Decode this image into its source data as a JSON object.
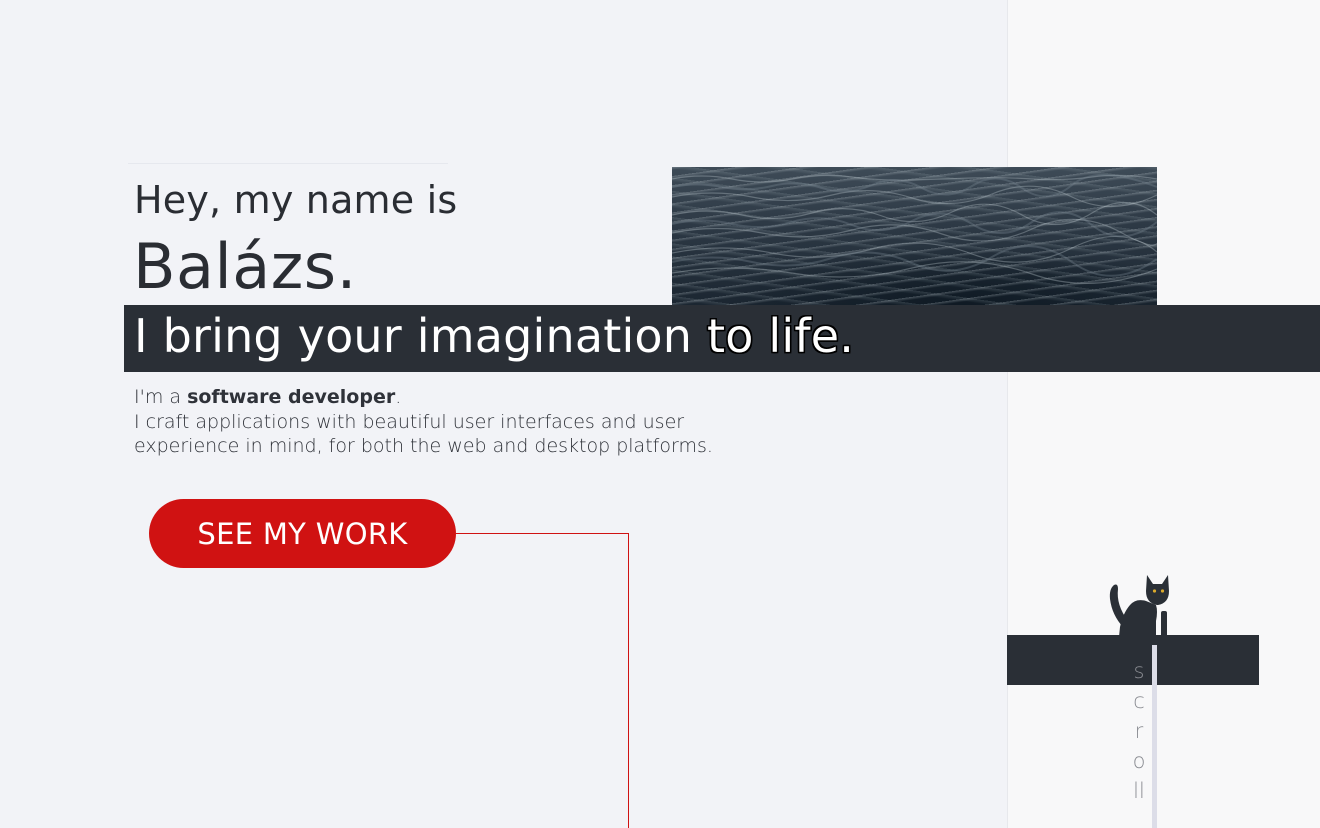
{
  "hero": {
    "greeting": "Hey, my name is",
    "name": "Balázs.",
    "tagline_main": "I bring your imagination",
    "tagline_outline": "to life.",
    "intro_prefix": "I'm a ",
    "intro_role": "software developer",
    "intro_suffix": ".",
    "intro_line2": "I craft applications with beautiful user interfaces and user experience in mind, for both the web and desktop platforms.",
    "cta_label": "SEE MY WORK"
  },
  "scroll": {
    "label": "scroll"
  },
  "colors": {
    "accent": "#d01212",
    "dark_bar": "#2a2f36",
    "background": "#f2f3f7"
  },
  "icons": {
    "scroll_mascot": "cat-icon"
  }
}
